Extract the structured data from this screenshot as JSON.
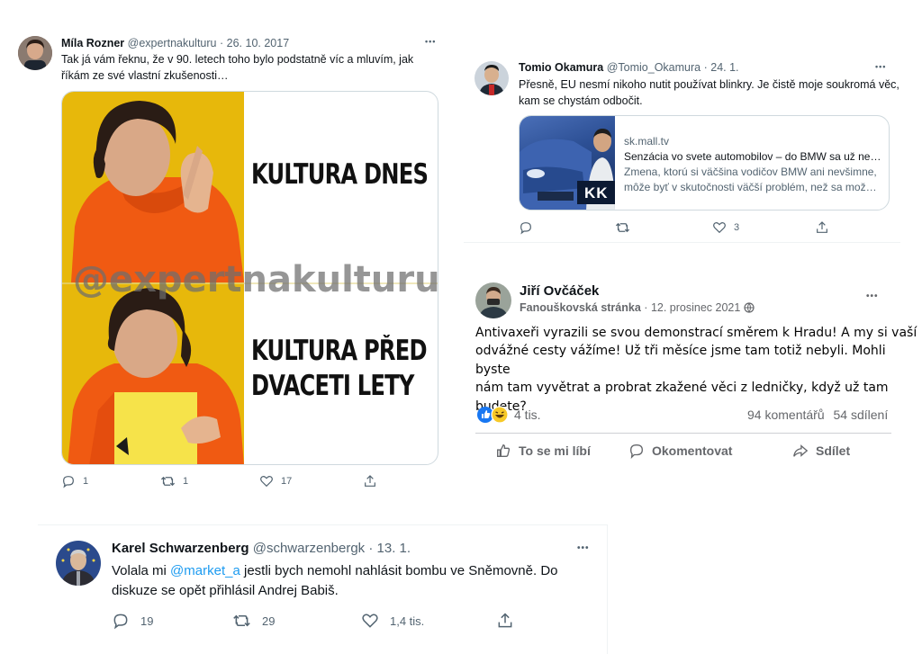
{
  "tweet1": {
    "author_name": "Míla Rozner",
    "handle": "@expertnakulturu",
    "dot": "·",
    "date": "26. 10. 2017",
    "more": "•••",
    "text_line1": "Tak já vám řeknu, že v 90. letech toho bylo podstatně víc a mluvím, jak",
    "text_line2": "říkám ze své vlastní zkušenosti…",
    "meme": {
      "top_text": "KULTURA DNES",
      "bottom_text_line1": "KULTURA PŘED",
      "bottom_text_line2": "DVACETI LETY",
      "watermark": "@expertnakulturu"
    },
    "replies": "1",
    "retweets": "1",
    "likes": "17"
  },
  "tweet2": {
    "author_name": "Tomio Okamura",
    "handle": "@Tomio_Okamura",
    "dot": "·",
    "date": "24. 1.",
    "more": "•••",
    "text_line1": "Přesně, EU nesmí nikoho nutit používat blinkry. Je čistě moje soukromá věc,",
    "text_line2": "kam se chystám odbočit.",
    "card": {
      "domain": "sk.mall.tv",
      "title": "Senzácia vo svete automobilov – do BMW sa už ne…",
      "desc_line1": "Zmena, ktorú si väčšina vodičov BMW ani nevšimne,",
      "desc_line2": "môže byť v skutočnosti väčší problém, než sa mož…",
      "thumb_logo": "KK"
    },
    "replies": "",
    "retweets": "",
    "likes": "3"
  },
  "fbpost": {
    "author_name": "Jiří Ovčáček",
    "page_name": "Fanouškovská stránka",
    "dot": "·",
    "date": "12. prosinec 2021",
    "more": "•••",
    "text_line1": "Antivaxeři vyrazili se svou demonstrací směrem k Hradu! A my si vaší",
    "text_line2": "odvážné cesty vážíme! Už tři měsíce jsme tam totiž nebyli. Mohli byste",
    "text_line3": "nám tam vyvětrat a probrat zkažené věci z ledničky, když už tam",
    "text_line4": "budete?",
    "reactions_count": "4 tis.",
    "comments": "94 komentářů",
    "shares": "54 sdílení",
    "like_label": "To se mi líbí",
    "comment_label": "Okomentovat",
    "share_label": "Sdílet"
  },
  "tweet3": {
    "author_name": "Karel Schwarzenberg",
    "handle": "@schwarzenbergk",
    "dot": "·",
    "date": "13. 1.",
    "more": "•••",
    "text_pre": "Volala mi ",
    "mention": "@market_a",
    "text_post": " jestli bych nemohl nahlásit bombu ve Sněmovně. Do",
    "text_line2": "diskuze se opět přihlásil Andrej Babiš.",
    "replies": "19",
    "retweets": "29",
    "likes": "1,4 tis."
  },
  "colors": {
    "twitter_blue": "#1d9bf0",
    "meme_yellow": "#e7b80b",
    "jacket_orange": "#f05a12",
    "fb_like": "#1877f2"
  }
}
